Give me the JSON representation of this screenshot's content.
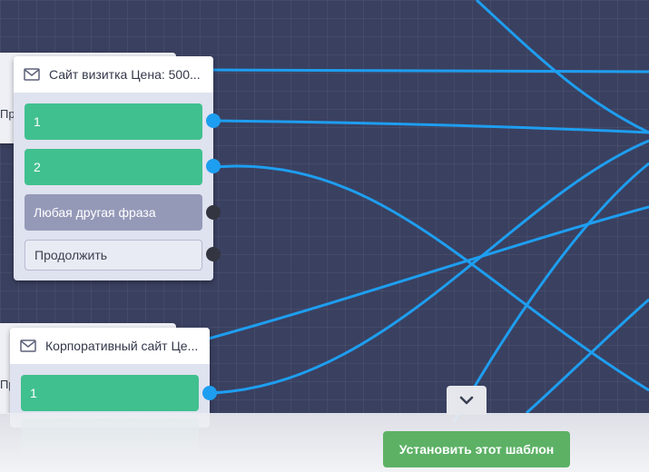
{
  "nodes": [
    {
      "title": "Сайт визитка Цена: 500...",
      "behind_text": "Пр",
      "buttons": [
        {
          "label": "1",
          "style": "green"
        },
        {
          "label": "2",
          "style": "green"
        },
        {
          "label": "Любая другая фраза",
          "style": "gray"
        },
        {
          "label": "Продолжить",
          "style": "outline"
        }
      ]
    },
    {
      "title": "Корпоративный сайт Це...",
      "behind_text": "Пр",
      "buttons": [
        {
          "label": "1",
          "style": "green"
        }
      ]
    }
  ],
  "footer": {
    "install_button": "Установить этот шаблон",
    "collapse_icon": "chevron-down-icon"
  },
  "colors": {
    "canvas": "#3a4060",
    "wire": "#1e9ef0",
    "green_button": "#41c08f",
    "install_button": "#5cb165"
  }
}
